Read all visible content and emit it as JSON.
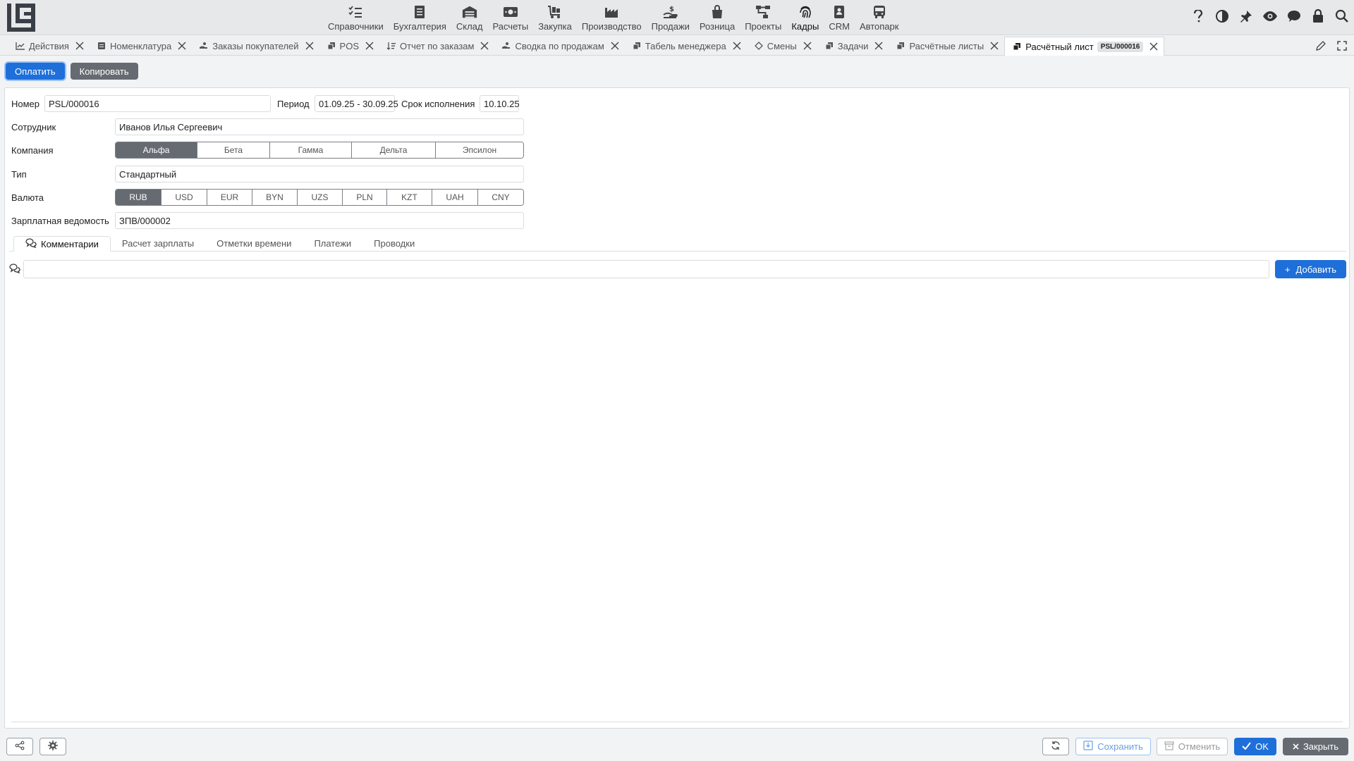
{
  "nav": {
    "items": [
      {
        "label": "Справочники",
        "icon": "checklist-icon"
      },
      {
        "label": "Бухгалтерия",
        "icon": "ledger-icon"
      },
      {
        "label": "Склад",
        "icon": "warehouse-icon"
      },
      {
        "label": "Расчеты",
        "icon": "money-icon"
      },
      {
        "label": "Закупка",
        "icon": "cart-icon"
      },
      {
        "label": "Производство",
        "icon": "factory-icon"
      },
      {
        "label": "Продажи",
        "icon": "hand-coin-icon"
      },
      {
        "label": "Розница",
        "icon": "shopping-bag-icon"
      },
      {
        "label": "Проекты",
        "icon": "project-tree-icon"
      },
      {
        "label": "Кадры",
        "icon": "fingerprint-icon"
      },
      {
        "label": "CRM",
        "icon": "contact-card-icon"
      },
      {
        "label": "Автопарк",
        "icon": "bus-icon"
      }
    ],
    "active": "Кадры"
  },
  "tabs": [
    {
      "label": "Действия",
      "icon": "chart-line-icon"
    },
    {
      "label": "Номенклатура",
      "icon": "catalog-icon"
    },
    {
      "label": "Заказы покупателей",
      "icon": "hand-coin-icon"
    },
    {
      "label": "POS",
      "icon": "copy-icon"
    },
    {
      "label": "Отчет по заказам",
      "icon": "sort-icon"
    },
    {
      "label": "Сводка по продажам",
      "icon": "hand-coin-icon"
    },
    {
      "label": "Табель менеджера",
      "icon": "copy-icon"
    },
    {
      "label": "Смены",
      "icon": "shift-icon"
    },
    {
      "label": "Задачи",
      "icon": "copy-icon"
    },
    {
      "label": "Расчётные листы",
      "icon": "copy-icon"
    },
    {
      "label": "Расчётный лист",
      "icon": "copy-icon",
      "badge": "PSL/000016",
      "active": true
    }
  ],
  "actions": {
    "pay": "Оплатить",
    "copy": "Копировать"
  },
  "form": {
    "number_label": "Номер",
    "number": "PSL/000016",
    "period_label": "Период",
    "period": "01.09.25 - 30.09.25",
    "due_label": "Срок исполнения",
    "due": "10.10.25",
    "employee_label": "Сотрудник",
    "employee": "Иванов Илья Сергеевич",
    "company_label": "Компания",
    "companies": [
      "Альфа",
      "Бета",
      "Гамма",
      "Дельта",
      "Эпсилон"
    ],
    "company_selected": "Альфа",
    "type_label": "Тип",
    "type": "Стандартный",
    "currency_label": "Валюта",
    "currencies": [
      "RUB",
      "USD",
      "EUR",
      "BYN",
      "UZS",
      "PLN",
      "KZT",
      "UAH",
      "CNY"
    ],
    "currency_selected": "RUB",
    "payroll_label": "Зарплатная ведомость",
    "payroll": "ЗПВ/000002"
  },
  "inner_tabs": [
    "Комментарии",
    "Расчет зарплаты",
    "Отметки времени",
    "Платежи",
    "Проводки"
  ],
  "inner_tab_active": "Комментарии",
  "comment": {
    "value": "",
    "add_label": "Добавить"
  },
  "footer": {
    "save": "Сохранить",
    "cancel": "Отменить",
    "ok": "OK",
    "close": "Закрыть"
  },
  "colors": {
    "accent": "#1e6fd9",
    "dark_button": "#666b72",
    "background": "#f1f3f5"
  }
}
